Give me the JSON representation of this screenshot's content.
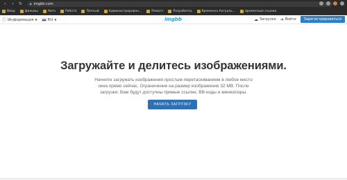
{
  "browser": {
    "url": "imgbb.com",
    "bookmarks": [
      {
        "label": "Ввод",
        "folder": true
      },
      {
        "label": "фильмы",
        "folder": true
      },
      {
        "label": "Авто",
        "folder": true
      },
      {
        "label": "Работа",
        "folder": true
      },
      {
        "label": "Личный",
        "folder": true
      },
      {
        "label": "Администрирован...",
        "folder": true
      },
      {
        "label": "Ремонт",
        "folder": true
      },
      {
        "label": "Разработка",
        "folder": true
      },
      {
        "label": "Временно Актуаль...",
        "folder": true
      },
      {
        "label": "временные ссылки",
        "folder": true
      }
    ]
  },
  "header": {
    "info_label": "Информация",
    "lang_label": "RU",
    "logo": "imgbb",
    "upload_label": "Загрузка",
    "login_label": "Войти",
    "signup_label": "Зарегистрироваться"
  },
  "hero": {
    "title": "Загружайте и делитесь изображениями.",
    "desc_line1": "Начните загружать изображения простым перетаскиванием в любое место",
    "desc_line2": "окна прямо сейчас. Ограничение на размер изображения 32 MB. После",
    "desc_line3": "загрузки, Вам будут доступны прямые ссылки, BB-коды и миниатюры.",
    "cta_label": "НАЧАТЬ ЗАГРУЗКУ"
  }
}
